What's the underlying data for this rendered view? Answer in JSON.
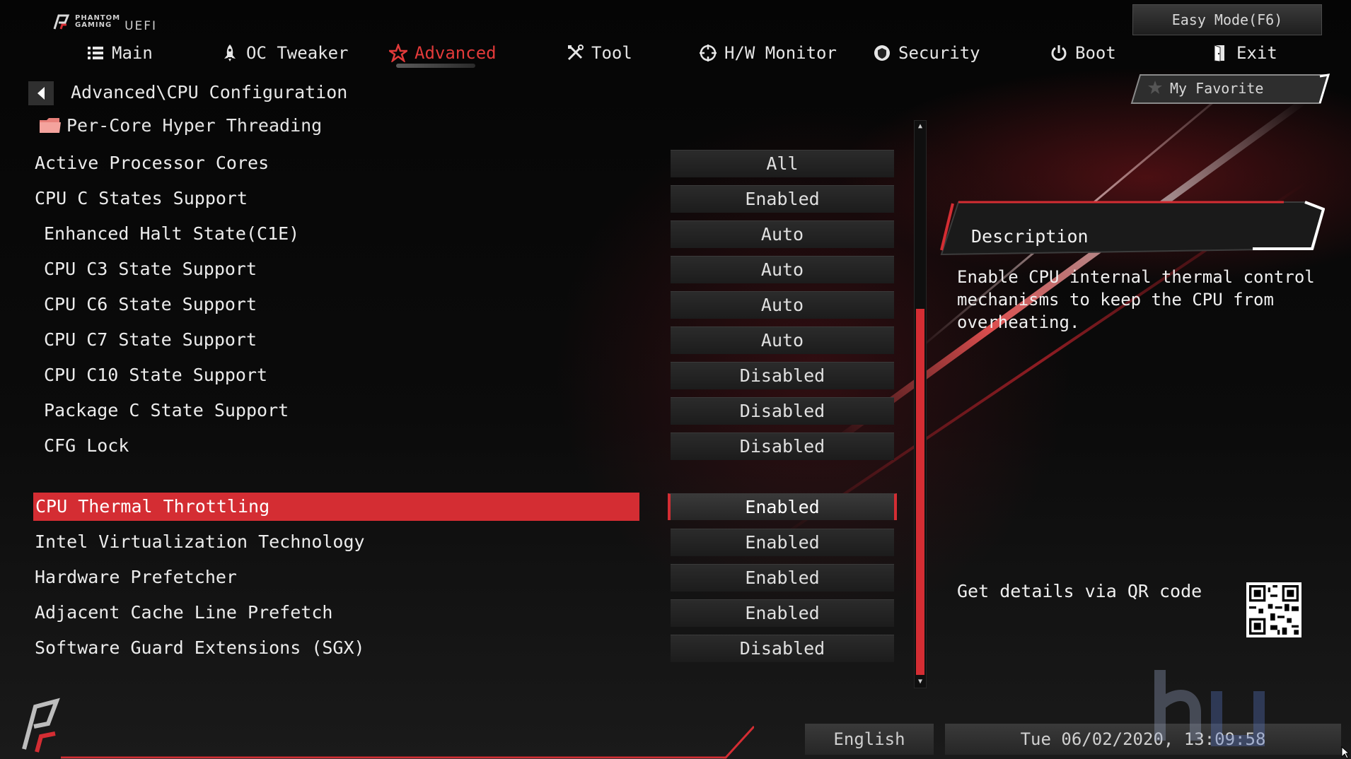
{
  "brand": {
    "line1": "PHANTOM",
    "line2": "GAMING",
    "product": "UEFI"
  },
  "easy_mode_label": "Easy Mode(F6)",
  "nav": {
    "items": [
      {
        "label": "Main",
        "icon": "list-icon"
      },
      {
        "label": "OC Tweaker",
        "icon": "rocket-icon"
      },
      {
        "label": "Advanced",
        "icon": "star-icon",
        "active": true
      },
      {
        "label": "Tool",
        "icon": "tools-icon"
      },
      {
        "label": "H/W Monitor",
        "icon": "target-icon"
      },
      {
        "label": "Security",
        "icon": "shield-icon"
      },
      {
        "label": "Boot",
        "icon": "power-icon"
      },
      {
        "label": "Exit",
        "icon": "exit-door-icon"
      }
    ]
  },
  "breadcrumb": "Advanced\\CPU Configuration",
  "submenu_label": "Per-Core Hyper Threading",
  "my_favorite_label": "My Favorite",
  "settings": [
    {
      "label": "Active Processor Cores",
      "value": "All"
    },
    {
      "label": "CPU C States Support",
      "value": "Enabled"
    },
    {
      "label": "Enhanced Halt State(C1E)",
      "value": "Auto"
    },
    {
      "label": "CPU C3 State Support",
      "value": "Auto"
    },
    {
      "label": "CPU C6 State Support",
      "value": "Auto"
    },
    {
      "label": "CPU C7 State Support",
      "value": "Auto"
    },
    {
      "label": "CPU C10 State Support",
      "value": "Disabled"
    },
    {
      "label": "Package C State Support",
      "value": "Disabled"
    },
    {
      "label": "CFG Lock",
      "value": "Disabled"
    },
    {
      "label": "CPU Thermal Throttling",
      "value": "Enabled",
      "selected": true
    },
    {
      "label": "Intel Virtualization Technology",
      "value": "Enabled"
    },
    {
      "label": "Hardware Prefetcher",
      "value": "Enabled"
    },
    {
      "label": "Adjacent Cache Line Prefetch",
      "value": "Enabled"
    },
    {
      "label": "Software Guard Extensions (SGX)",
      "value": "Disabled"
    }
  ],
  "description": {
    "title": "Description",
    "text": "Enable CPU internal thermal control mechanisms to keep the CPU from overheating.",
    "qr_label": "Get details via QR code"
  },
  "footer": {
    "language": "English",
    "datetime": "Tue 06/02/2020, 13:09:58"
  },
  "colors": {
    "accent": "#d42d33",
    "background": "#060606"
  }
}
